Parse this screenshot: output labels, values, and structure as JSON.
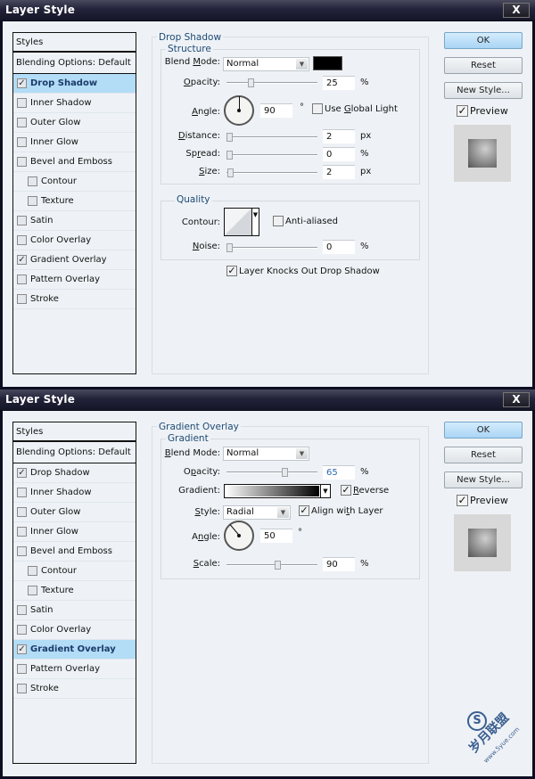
{
  "dialogs": [
    {
      "title": "Layer Style",
      "close_label": "X",
      "styles_header": "Styles",
      "blending_options": "Blending Options: Default",
      "style_items": [
        {
          "label": "Drop Shadow",
          "checked": true,
          "active": true,
          "sub": false
        },
        {
          "label": "Inner Shadow",
          "checked": false,
          "active": false,
          "sub": false
        },
        {
          "label": "Outer Glow",
          "checked": false,
          "active": false,
          "sub": false
        },
        {
          "label": "Inner Glow",
          "checked": false,
          "active": false,
          "sub": false
        },
        {
          "label": "Bevel and Emboss",
          "checked": false,
          "active": false,
          "sub": false
        },
        {
          "label": "Contour",
          "checked": false,
          "active": false,
          "sub": true
        },
        {
          "label": "Texture",
          "checked": false,
          "active": false,
          "sub": true
        },
        {
          "label": "Satin",
          "checked": false,
          "active": false,
          "sub": false
        },
        {
          "label": "Color Overlay",
          "checked": false,
          "active": false,
          "sub": false
        },
        {
          "label": "Gradient Overlay",
          "checked": true,
          "active": false,
          "sub": false
        },
        {
          "label": "Pattern Overlay",
          "checked": false,
          "active": false,
          "sub": false
        },
        {
          "label": "Stroke",
          "checked": false,
          "active": false,
          "sub": false
        }
      ],
      "buttons": {
        "ok": "OK",
        "reset": "Reset",
        "new_style": "New Style..."
      },
      "preview_label": "Preview",
      "preview_checked": true,
      "panel": {
        "section_title": "Drop Shadow",
        "group1_title": "Structure",
        "blend_mode_label": "Blend Mode:",
        "blend_mode_value": "Normal",
        "shadow_color": "#000000",
        "opacity_label": "Opacity:",
        "opacity_value": "25",
        "opacity_unit": "%",
        "angle_label": "Angle:",
        "angle_value": "90",
        "angle_unit": "°",
        "use_global_light_label": "Use Global Light",
        "use_global_light_checked": false,
        "distance_label": "Distance:",
        "distance_value": "2",
        "distance_unit": "px",
        "spread_label": "Spread:",
        "spread_value": "0",
        "spread_unit": "%",
        "size_label": "Size:",
        "size_value": "2",
        "size_unit": "px",
        "group2_title": "Quality",
        "contour_label": "Contour:",
        "anti_aliased_label": "Anti-aliased",
        "anti_aliased_checked": false,
        "noise_label": "Noise:",
        "noise_value": "0",
        "noise_unit": "%",
        "knockout_label": "Layer Knocks Out Drop Shadow",
        "knockout_checked": true
      }
    },
    {
      "title": "Layer Style",
      "close_label": "X",
      "styles_header": "Styles",
      "blending_options": "Blending Options: Default",
      "style_items": [
        {
          "label": "Drop Shadow",
          "checked": true,
          "active": false,
          "sub": false
        },
        {
          "label": "Inner Shadow",
          "checked": false,
          "active": false,
          "sub": false
        },
        {
          "label": "Outer Glow",
          "checked": false,
          "active": false,
          "sub": false
        },
        {
          "label": "Inner Glow",
          "checked": false,
          "active": false,
          "sub": false
        },
        {
          "label": "Bevel and Emboss",
          "checked": false,
          "active": false,
          "sub": false
        },
        {
          "label": "Contour",
          "checked": false,
          "active": false,
          "sub": true
        },
        {
          "label": "Texture",
          "checked": false,
          "active": false,
          "sub": true
        },
        {
          "label": "Satin",
          "checked": false,
          "active": false,
          "sub": false
        },
        {
          "label": "Color Overlay",
          "checked": false,
          "active": false,
          "sub": false
        },
        {
          "label": "Gradient Overlay",
          "checked": true,
          "active": true,
          "sub": false
        },
        {
          "label": "Pattern Overlay",
          "checked": false,
          "active": false,
          "sub": false
        },
        {
          "label": "Stroke",
          "checked": false,
          "active": false,
          "sub": false
        }
      ],
      "buttons": {
        "ok": "OK",
        "reset": "Reset",
        "new_style": "New Style..."
      },
      "preview_label": "Preview",
      "preview_checked": true,
      "panel": {
        "section_title": "Gradient Overlay",
        "group1_title": "Gradient",
        "blend_mode_label": "Blend Mode:",
        "blend_mode_value": "Normal",
        "opacity_label": "Opacity:",
        "opacity_value": "65",
        "opacity_unit": "%",
        "gradient_label": "Gradient:",
        "gradient_from": "#ffffff",
        "gradient_to": "#000000",
        "reverse_label": "Reverse",
        "reverse_checked": true,
        "style_label": "Style:",
        "style_value": "Radial",
        "align_label": "Align with Layer",
        "align_checked": true,
        "angle_label": "Angle:",
        "angle_value": "50",
        "angle_unit": "°",
        "scale_label": "Scale:",
        "scale_value": "90",
        "scale_unit": "%"
      }
    }
  ],
  "watermark": {
    "text": "岁月联盟",
    "url": "www.5yue.com",
    "logo_letter": "S"
  }
}
